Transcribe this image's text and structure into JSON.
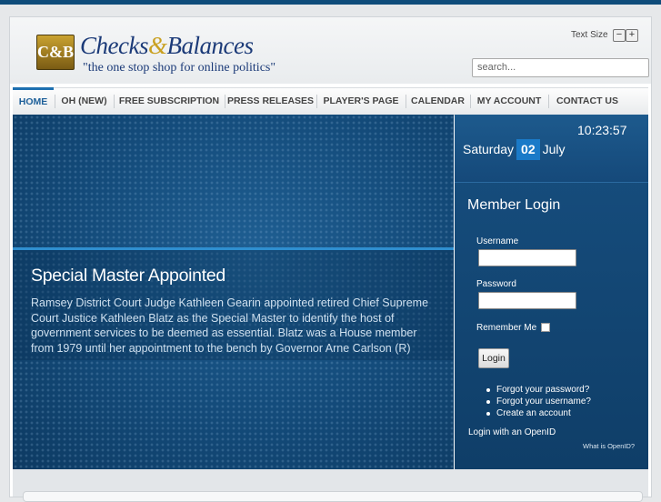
{
  "header": {
    "logo_monogram": "C&B",
    "logo_title_part1": "Checks",
    "logo_title_amp": "&",
    "logo_title_part2": "Balances",
    "tagline": "\"the one stop shop for online politics\"",
    "text_size_label": "Text Size",
    "text_size_decrease": "−",
    "text_size_increase": "+",
    "search_placeholder": "search..."
  },
  "nav": {
    "items": [
      {
        "label": "HOME",
        "active": true
      },
      {
        "label": "OH (NEW)"
      },
      {
        "label": "FREE SUBSCRIPTION"
      },
      {
        "label": "PRESS RELEASES"
      },
      {
        "label": "PLAYER'S PAGE"
      },
      {
        "label": "CALENDAR"
      },
      {
        "label": "MY ACCOUNT"
      },
      {
        "label": "CONTACT US"
      }
    ]
  },
  "hero": {
    "title": "Special Master Appointed",
    "text": "Ramsey District Court Judge Kathleen Gearin appointed retired Chief Supreme Court Justice Kathleen Blatz as the Special Master to identify the host of government services to be deemed as essential. Blatz was a House member from 1979 until her appointment to the bench by Governor Arne Carlson (R) in..."
  },
  "sidebar": {
    "time": "10:23:57",
    "weekday": "Saturday",
    "day": "02",
    "month": "July",
    "login_title": "Member Login",
    "username_label": "Username",
    "password_label": "Password",
    "remember_label": "Remember Me",
    "login_button": "Login",
    "links": [
      "Forgot your password?",
      "Forgot your username?",
      "Create an account"
    ],
    "openid_label": "Login with an OpenID",
    "whatis_openid": "What is OpenID?"
  },
  "colors": {
    "brand_blue": "#1b3a78",
    "brand_gold": "#c9a020",
    "hero_blue": "#134a79",
    "accent_blue": "#1a7ac8"
  }
}
